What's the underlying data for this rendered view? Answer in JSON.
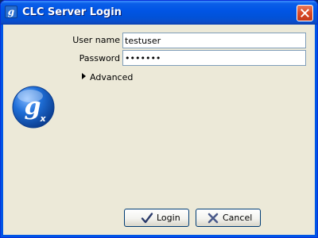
{
  "window": {
    "title": "CLC Server Login",
    "icon_letter": "g"
  },
  "form": {
    "username_label": "User name",
    "username_value": "testuser",
    "password_label": "Password",
    "password_value": "1234567"
  },
  "advanced": {
    "label": "Advanced",
    "expanded": false
  },
  "logo": {
    "letter": "g",
    "subscript": "x"
  },
  "buttons": {
    "login_label": "Login",
    "cancel_label": "Cancel"
  },
  "colors": {
    "titlebar": "#0155e5",
    "dialog_bg": "#ece9d8",
    "close_button": "#d94a27",
    "logo_blue": "#1060c8",
    "login_check": "#2a3a6a",
    "cancel_x": "#4a5a8a"
  }
}
